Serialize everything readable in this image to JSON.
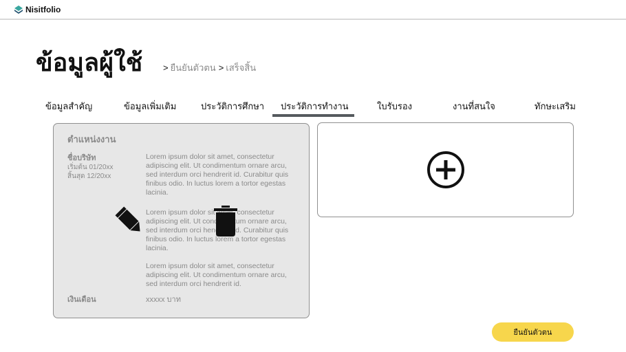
{
  "app": {
    "name": "Nisitfolio"
  },
  "header": {
    "title": "ข้อมูลผู้ใช้",
    "steps": [
      "ยืนยันตัวตน",
      "เสร็จสิ้น"
    ],
    "step_separator": ">"
  },
  "tabs": [
    {
      "label": "ข้อมูลสำคัญ",
      "active": false
    },
    {
      "label": "ข้อมูลเพิ่มเติม",
      "active": false
    },
    {
      "label": "ประวัติการศึกษา",
      "active": false
    },
    {
      "label": "ประวัติการทำงาน",
      "active": true
    },
    {
      "label": "ใบรับรอง",
      "active": false
    },
    {
      "label": "งานที่สนใจ",
      "active": false
    },
    {
      "label": "ทักษะเสริม",
      "active": false
    }
  ],
  "work_card": {
    "position": "ตำแหน่งงาน",
    "company": "ชื่อบริษัท",
    "start": "เริ่มต้น 01/20xx",
    "end": "สิ้นสุด 12/20xx",
    "descriptions": [
      "Lorem ipsum dolor sit amet, consectetur adipiscing elit. Ut condimentum ornare arcu, sed interdum orci hendrerit id. Curabitur quis finibus odio. In luctus lorem a tortor egestas lacinia.",
      "Lorem ipsum dolor sit amet, consectetur adipiscing elit. Ut condimentum ornare arcu, sed interdum orci hendrerit id. Curabitur quis finibus odio. In luctus lorem a tortor egestas lacinia.",
      "Lorem ipsum dolor sit amet, consectetur adipiscing elit. Ut condimentum ornare arcu, sed interdum orci hendrerit id."
    ],
    "salary_label": "เงินเดือน",
    "salary_value": "xxxxx บาท"
  },
  "actions": {
    "confirm_label": "ยืนยันตัวตน"
  },
  "icons": {
    "logo": "logo-diamond-icon",
    "edit": "pencil-icon",
    "delete": "trash-icon",
    "add": "plus-circle-icon"
  },
  "colors": {
    "accent": "#f7d64c",
    "tab_underline": "#555a5e",
    "card_bg": "#e7e7e7",
    "muted_text": "#8a8a8a"
  }
}
